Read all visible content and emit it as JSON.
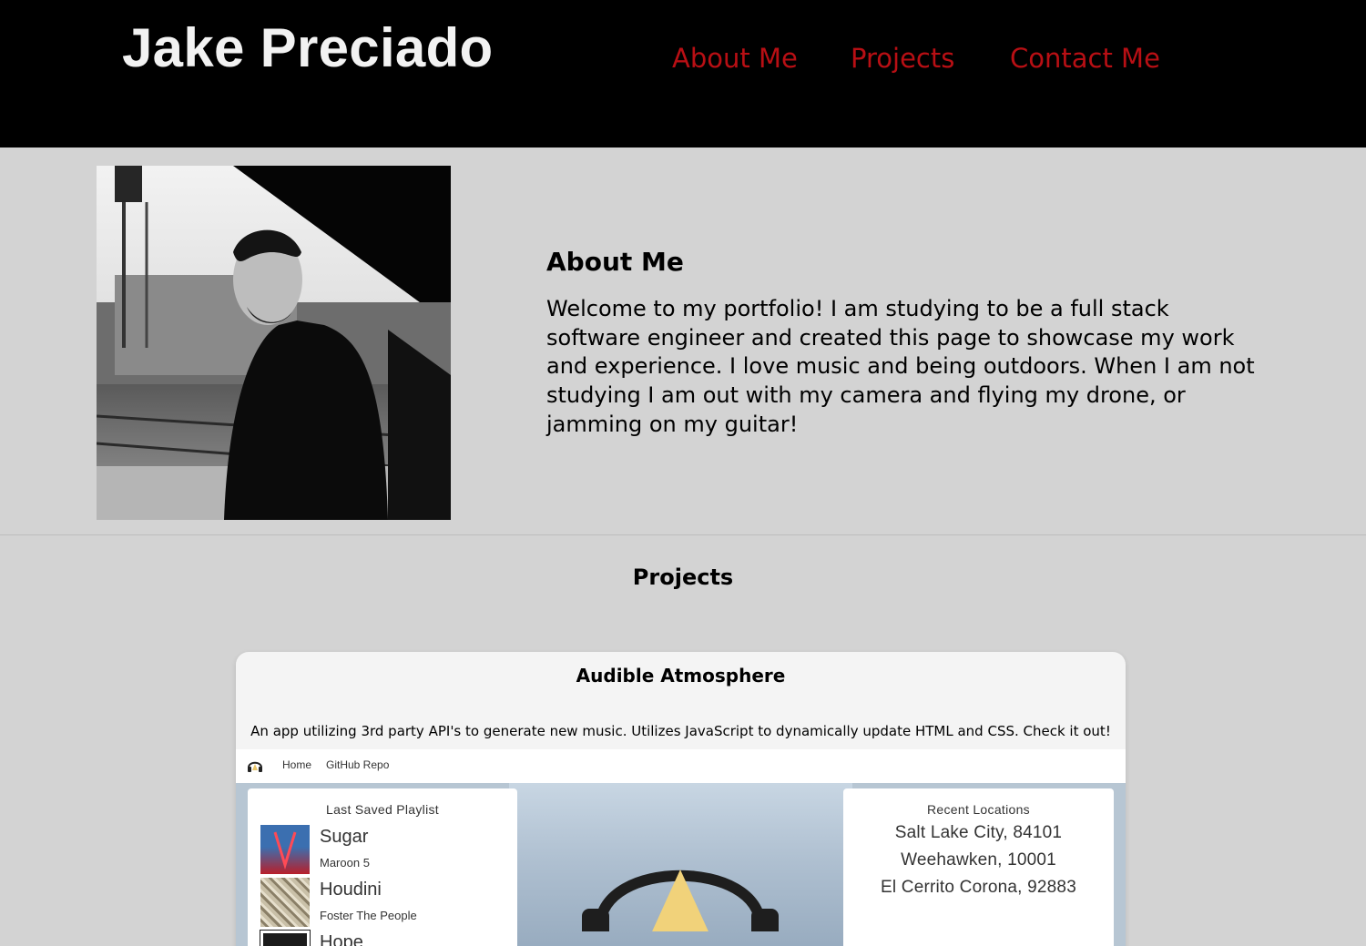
{
  "header": {
    "name": "Jake Preciado",
    "nav": [
      "About Me",
      "Projects",
      "Contact Me"
    ]
  },
  "about": {
    "title": "About Me",
    "text": "Welcome to my portfolio! I am studying to be a full stack software engineer and created this page to showcase my work and experience. I love music and being outdoors. When I am not studying I am out with my camera and flying my drone, or jamming on my guitar!"
  },
  "projects": {
    "title": "Projects",
    "items": [
      {
        "title": "Audible Atmosphere",
        "description": "An app utilizing 3rd party API's to generate new music. Utilizes JavaScript to dynamically update HTML and CSS. Check it out!",
        "preview": {
          "nav": [
            "Home",
            "GitHub Repo"
          ],
          "playlist_title": "Last Saved Playlist",
          "songs": [
            {
              "title": "Sugar",
              "artist": "Maroon 5"
            },
            {
              "title": "Houdini",
              "artist": "Foster The People"
            },
            {
              "title": "Hope",
              "artist": ""
            }
          ],
          "locations_title": "Recent Locations",
          "locations": [
            "Salt Lake City, 84101",
            "Weehawken, 10001",
            "El Cerrito Corona, 92883"
          ]
        }
      }
    ]
  },
  "colors": {
    "header_bg": "#000000",
    "nav_link": "#b80f14",
    "page_bg": "#d3d3d3",
    "card_bg": "#f4f4f4"
  }
}
